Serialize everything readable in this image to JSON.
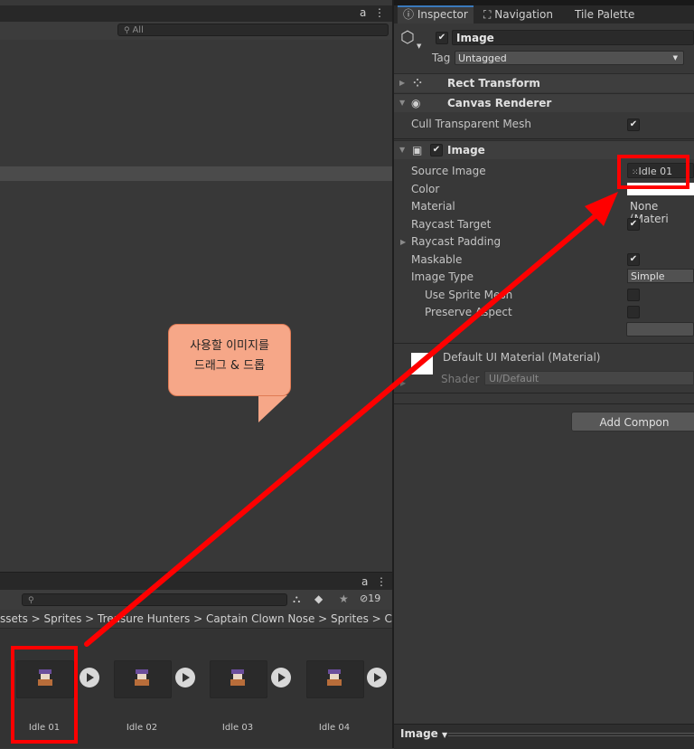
{
  "hierarchy": {
    "lock_label": "a",
    "search_placeholder": "All"
  },
  "project": {
    "lock_label": "a",
    "hidden_count": "19",
    "breadcrumb": "ssets > Sprites > Treasure Hunters > Captain Clown Nose > Sprites > Capta",
    "assets": [
      {
        "label": "Idle 01"
      },
      {
        "label": "Idle 02"
      },
      {
        "label": "Idle 03"
      },
      {
        "label": "Idle 04"
      }
    ]
  },
  "inspector": {
    "tabs": [
      {
        "label": "Inspector"
      },
      {
        "label": "Navigation"
      },
      {
        "label": "Tile Palette"
      }
    ],
    "object_name": "Image",
    "tag_label": "Tag",
    "tag_value": "Untagged",
    "components": {
      "rect_transform": "Rect Transform",
      "canvas_renderer": "Canvas Renderer",
      "cull_label": "Cull Transparent Mesh",
      "image": "Image"
    },
    "image_fields": {
      "source_image_label": "Source Image",
      "source_image_value": "Idle 01",
      "color_label": "Color",
      "material_label": "Material",
      "material_value": "None (Materi",
      "raycast_target_label": "Raycast Target",
      "raycast_padding_label": "Raycast Padding",
      "maskable_label": "Maskable",
      "image_type_label": "Image Type",
      "image_type_value": "Simple",
      "use_sprite_mesh_label": "Use Sprite Mesh",
      "preserve_aspect_label": "Preserve Aspect"
    },
    "material_block": {
      "title": "Default UI Material (Material)",
      "shader_label": "Shader",
      "shader_value": "UI/Default"
    },
    "add_component": "Add Compon",
    "bottom_label": "Image"
  },
  "annotation": {
    "callout_line1": "사용할 이미지를",
    "callout_line2": "드래그 & 드롭",
    "color": "#ff0000"
  }
}
